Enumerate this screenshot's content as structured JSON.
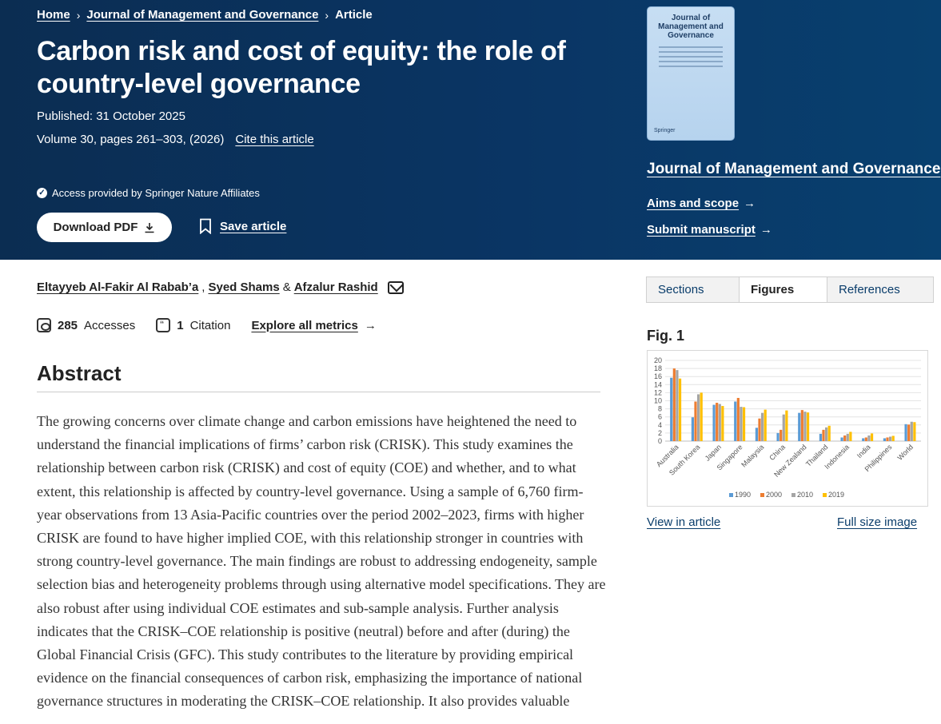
{
  "breadcrumb": {
    "home": "Home",
    "journal": "Journal of Management and Governance",
    "current": "Article"
  },
  "article": {
    "title": "Carbon risk and cost of equity: the role of country-level governance",
    "published": "Published: 31 October 2025",
    "volume": "Volume 30, pages 261–303, (2026)",
    "cite_label": "Cite this article",
    "access": "Access provided by Springer Nature Affiliates",
    "download_label": "Download PDF",
    "save_label": "Save article"
  },
  "cover": {
    "title": "Journal of Management and Governance",
    "publisher": "Springer"
  },
  "sidebar": {
    "journal_name": "Journal of Management and Governance",
    "aims_scope": "Aims and scope",
    "submit": "Submit manuscript",
    "arrow": "→"
  },
  "authors": {
    "a1": "Eltayyeb Al-Fakir Al Rabab’a",
    "sep1": ",",
    "a2": "Syed Shams",
    "sep2": "&",
    "a3": "Afzalur Rashid"
  },
  "metrics": {
    "accesses_count": "285",
    "accesses_label": "Accesses",
    "citations_count": "1",
    "citations_label": "Citation",
    "explore": "Explore all metrics",
    "arrow": "→"
  },
  "abstract": {
    "heading": "Abstract",
    "text": "The growing concerns over climate change and carbon emissions have heightened the need to understand the financial implications of firms’ carbon risk (CRISK). This study examines the relationship between carbon risk (CRISK) and cost of equity (COE) and whether, and to what extent, this relationship is affected by country-level governance. Using a sample of 6,760 firm-year observations from 13 Asia-Pacific countries over the period 2002–2023, firms with higher CRISK are found to have higher implied COE, with this relationship stronger in countries with strong country-level governance. The main findings are robust to addressing endogeneity, sample selection bias and heterogeneity problems through using alternative model specifications. They are also robust after using individual COE estimates and sub-sample analysis. Further analysis indicates that the CRISK–COE relationship is positive (neutral) before and after (during) the Global Financial Crisis (GFC). This study contributes to the literature by providing empirical evidence on the financial consequences of carbon risk, emphasizing the importance of national governance structures in moderating the CRISK–COE relationship. It also provides valuable"
  },
  "tabs": {
    "sections": "Sections",
    "figures": "Figures",
    "references": "References"
  },
  "figure": {
    "title": "Fig. 1",
    "view_in_article": "View in article",
    "full_size": "Full size image"
  },
  "chart_data": {
    "type": "bar",
    "categories": [
      "Australia",
      "South Korea",
      "Japan",
      "Singapore",
      "Malaysia",
      "China",
      "New Zealand",
      "Thailand",
      "Indonesia",
      "India",
      "Philippines",
      "World"
    ],
    "series": [
      {
        "name": "1990",
        "color": "#5b9bd5",
        "values": [
          15.7,
          5.9,
          9.0,
          9.8,
          3.3,
          2.0,
          7.0,
          1.8,
          0.9,
          0.7,
          0.7,
          4.2
        ]
      },
      {
        "name": "2000",
        "color": "#ed7d31",
        "values": [
          18.0,
          9.8,
          9.5,
          10.7,
          5.6,
          2.8,
          7.7,
          2.8,
          1.4,
          0.9,
          0.9,
          4.1
        ]
      },
      {
        "name": "2010",
        "color": "#a5a5a5",
        "values": [
          17.6,
          11.6,
          9.2,
          8.5,
          7.0,
          6.6,
          7.3,
          3.4,
          1.8,
          1.4,
          1.1,
          4.8
        ]
      },
      {
        "name": "2019",
        "color": "#ffc000",
        "values": [
          15.5,
          12.0,
          8.7,
          8.4,
          7.8,
          7.6,
          7.1,
          3.8,
          2.3,
          1.9,
          1.3,
          4.7
        ]
      }
    ],
    "ylim": [
      0,
      20
    ],
    "yticks": [
      "0",
      "2",
      "4",
      "6",
      "8",
      "10",
      "12",
      "14",
      "16",
      "18",
      "20"
    ],
    "legend": "bottom",
    "grid": true
  }
}
